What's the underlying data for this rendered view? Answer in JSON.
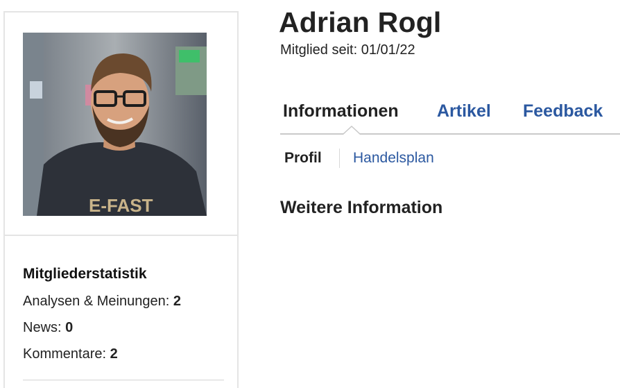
{
  "profile": {
    "name": "Adrian Rogl",
    "member_since": "Mitglied seit: 01/01/22"
  },
  "tabs": [
    {
      "label": "Informationen",
      "active": true
    },
    {
      "label": "Artikel",
      "active": false
    },
    {
      "label": "Feedback",
      "active": false
    }
  ],
  "subnav": [
    {
      "label": "Profil",
      "active": true
    },
    {
      "label": "Handelsplan",
      "active": false
    }
  ],
  "section": {
    "title": "Weitere Information"
  },
  "stats": {
    "title": "Mitgliederstatistik",
    "rows": [
      {
        "label": "Analysen & Meinungen: ",
        "value": "2"
      },
      {
        "label": "News: ",
        "value": "0"
      },
      {
        "label": "Kommentare: ",
        "value": "2"
      }
    ]
  },
  "colors": {
    "link": "#2b58a0",
    "text": "#222222",
    "border": "#e4e4e4"
  }
}
